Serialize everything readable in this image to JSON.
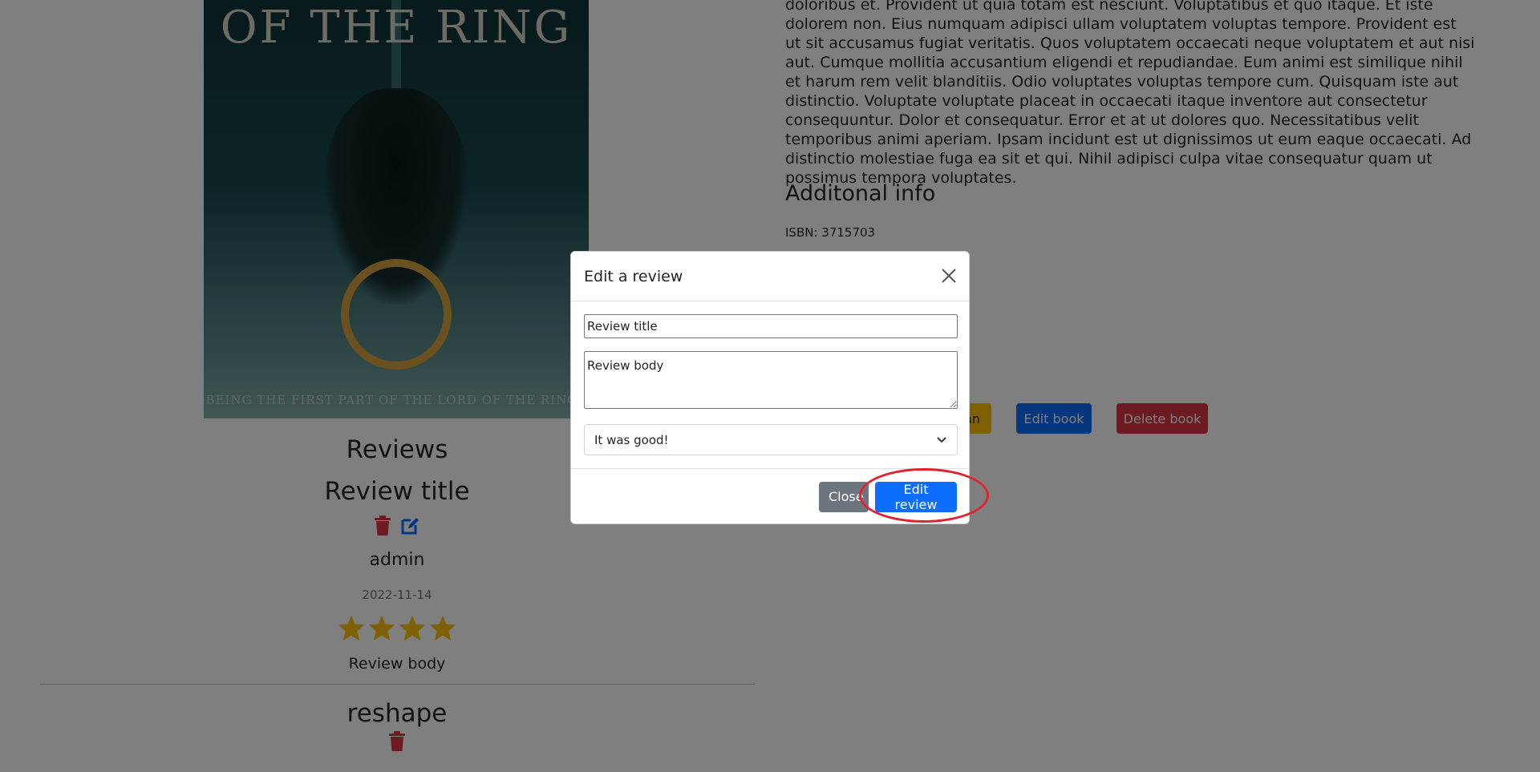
{
  "book": {
    "cover": {
      "title_text": "OF THE RING",
      "caption_text": "BEING THE FIRST PART OF THE LORD OF THE RINGS"
    },
    "description": "doloribus et. Provident ut quia totam est nesciunt. Voluptatibus et quo itaque. Et iste dolorem non. Eius numquam adipisci ullam voluptatem voluptas tempore. Provident est ut sit accusamus fugiat veritatis. Quos voluptatem occaecati neque voluptatem et aut nisi aut. Cumque mollitia accusantium eligendi et repudiandae. Eum animi est similique nihil et harum rem velit blanditiis. Odio voluptates voluptas tempore cum. Quisquam iste aut distinctio. Voluptate voluptate placeat in occaecati itaque inventore aut consectetur consequuntur. Dolor et consequatur. Error et at ut dolores quo. Necessitatibus velit temporibus animi aperiam. Ipsam incidunt est ut dignissimos ut eum eaque occaecati. Ad distinctio molestiae fuga ea sit et qui. Nihil adipisci culpa vitae consequatur quam ut possimus tempora voluptates.",
    "additional_heading": "Additonal info",
    "isbn": "ISBN: 3715703",
    "actions": {
      "loan_label": "an",
      "edit_label": "Edit book",
      "delete_label": "Delete book"
    }
  },
  "reviews": {
    "heading": "Reviews",
    "items": [
      {
        "title": "Review title",
        "user": "admin",
        "date": "2022-11-14",
        "stars": 4,
        "body": "Review body"
      },
      {
        "title": "reshape"
      }
    ]
  },
  "modal": {
    "title": "Edit a review",
    "title_field_value": "Review title",
    "body_field_value": "Review body",
    "rating_selected": "It was good!",
    "close_label": "Close",
    "submit_label": "Edit review"
  },
  "colors": {
    "primary": "#0d6efd",
    "danger": "#dc3545",
    "warning": "#ffc107",
    "secondary": "#6c757d",
    "star": "#ffc107",
    "highlight": "#e0242d"
  }
}
